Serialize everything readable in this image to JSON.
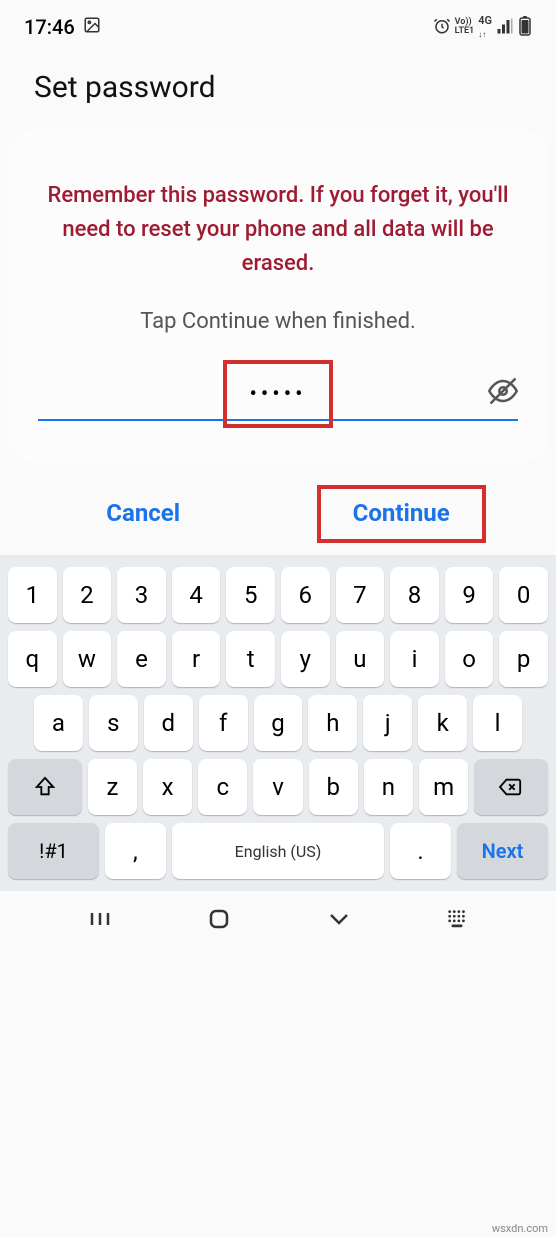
{
  "status": {
    "time": "17:46",
    "alarm": "⏰",
    "volte": "Vo))\nLTE1",
    "network": "4G",
    "signal": "📶",
    "battery": "🔋"
  },
  "page": {
    "title": "Set password",
    "warning": "Remember this password. If you forget it, you'll need to reset your phone and all data will be erased.",
    "instruction": "Tap Continue when finished.",
    "password_mask": "•••••"
  },
  "actions": {
    "cancel": "Cancel",
    "continue": "Continue"
  },
  "keyboard": {
    "row1": [
      "1",
      "2",
      "3",
      "4",
      "5",
      "6",
      "7",
      "8",
      "9",
      "0"
    ],
    "row2": [
      "q",
      "w",
      "e",
      "r",
      "t",
      "y",
      "u",
      "i",
      "o",
      "p"
    ],
    "row3": [
      "a",
      "s",
      "d",
      "f",
      "g",
      "h",
      "j",
      "k",
      "l"
    ],
    "row4": [
      "z",
      "x",
      "c",
      "v",
      "b",
      "n",
      "m"
    ],
    "symbols": "!#1",
    "comma": ",",
    "space": "English (US)",
    "period": ".",
    "next": "Next"
  },
  "watermark": "wsxdn.com"
}
